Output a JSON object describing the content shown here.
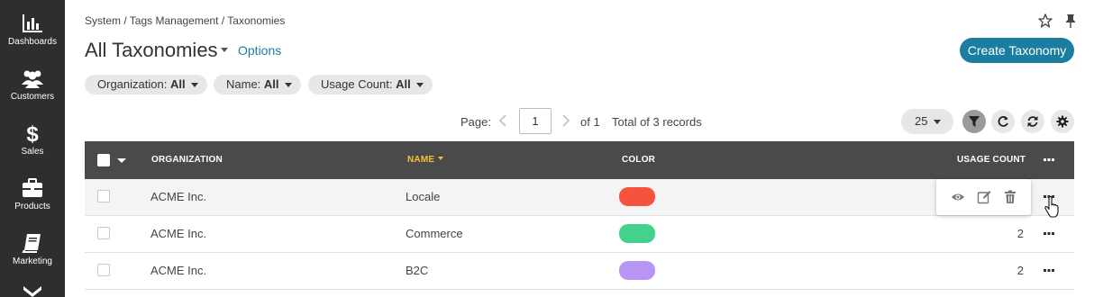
{
  "sidebar": {
    "items": [
      {
        "label": "Dashboards",
        "icon": "bar-chart-icon"
      },
      {
        "label": "Customers",
        "icon": "users-icon"
      },
      {
        "label": "Sales",
        "icon": "dollar-icon"
      },
      {
        "label": "Products",
        "icon": "briefcase-icon"
      },
      {
        "label": "Marketing",
        "icon": "book-icon"
      }
    ],
    "bg": "#2e2e2e"
  },
  "breadcrumb": "System / Tags Management / Taxonomies",
  "page": {
    "title": "All Taxonomies",
    "options_label": "Options",
    "create_label": "Create Taxonomy"
  },
  "filters": [
    {
      "label": "Organization:",
      "value": "All"
    },
    {
      "label": "Name:",
      "value": "All"
    },
    {
      "label": "Usage Count:",
      "value": "All"
    }
  ],
  "pager": {
    "page_label": "Page:",
    "current_page": "1",
    "of_label": "of 1",
    "total_label": "Total of 3 records",
    "per_page": "25"
  },
  "table": {
    "columns": {
      "organization": "ORGANIZATION",
      "name": "NAME",
      "color": "COLOR",
      "usage": "USAGE COUNT"
    },
    "sorted_by": "name",
    "rows": [
      {
        "organization": "ACME Inc.",
        "name": "Locale",
        "color": "#f5533d",
        "usage": ""
      },
      {
        "organization": "ACME Inc.",
        "name": "Commerce",
        "color": "#43d18c",
        "usage": "2"
      },
      {
        "organization": "ACME Inc.",
        "name": "B2C",
        "color": "#b795f5",
        "usage": "2"
      }
    ]
  },
  "colors": {
    "accent": "#1b7ea0",
    "header_bg": "#4a4a4a",
    "sort_highlight": "#f5c03d"
  }
}
